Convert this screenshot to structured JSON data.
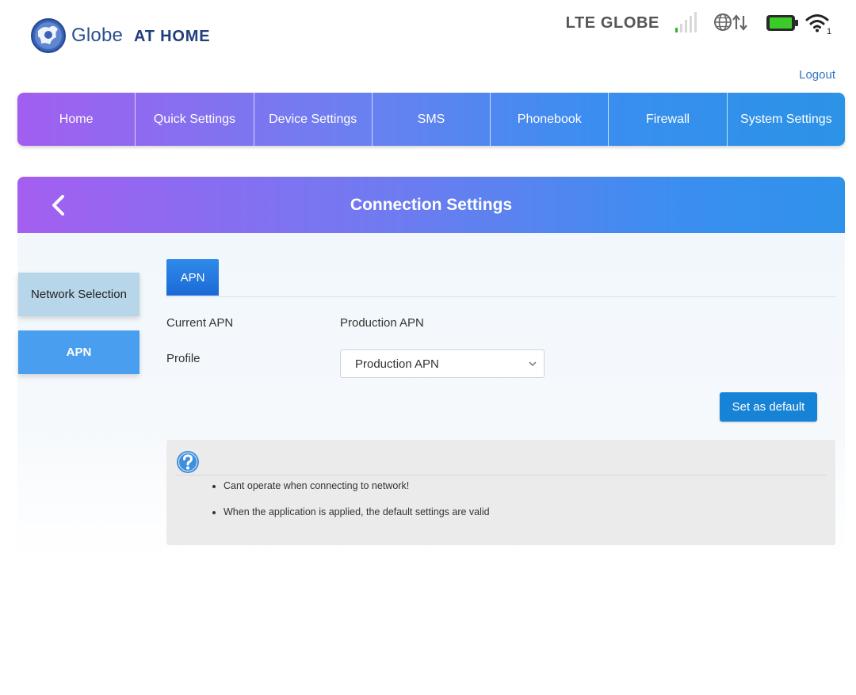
{
  "brand": {
    "globe_word": "Globe",
    "at_home": "AT HOME"
  },
  "status": {
    "network_text": "LTE GLOBE",
    "signal_icon": "signal-bars-icon",
    "connection_icon": "globe-data-icon",
    "battery_icon": "battery-icon",
    "wifi_icon": "wifi-icon",
    "wifi_clients": "1",
    "battery_color": "#3ccc2a"
  },
  "header": {
    "logout": "Logout"
  },
  "nav": {
    "items": [
      {
        "label": "Home"
      },
      {
        "label": "Quick Settings"
      },
      {
        "label": "Device Settings"
      },
      {
        "label": "SMS"
      },
      {
        "label": "Phonebook"
      },
      {
        "label": "Firewall"
      },
      {
        "label": "System Settings"
      }
    ]
  },
  "panel": {
    "title": "Connection Settings",
    "back_icon": "chevron-left-icon"
  },
  "sidebar": {
    "items": [
      {
        "label": "Network Selection",
        "active": false
      },
      {
        "label": "APN",
        "active": true
      }
    ]
  },
  "tabs": [
    {
      "label": "APN",
      "active": true
    }
  ],
  "form": {
    "current_apn_label": "Current APN",
    "current_apn_value": "Production APN",
    "profile_label": "Profile",
    "profile_selected": "Production APN",
    "set_default_button": "Set as default"
  },
  "help": {
    "icon": "question-circle-icon",
    "notes": [
      "Cant operate when connecting to network!",
      "When the application is applied, the default settings are valid"
    ]
  },
  "colors": {
    "accent_blue": "#1683d6",
    "gradient_start": "#a25ef0",
    "gradient_end": "#2b93e6"
  }
}
